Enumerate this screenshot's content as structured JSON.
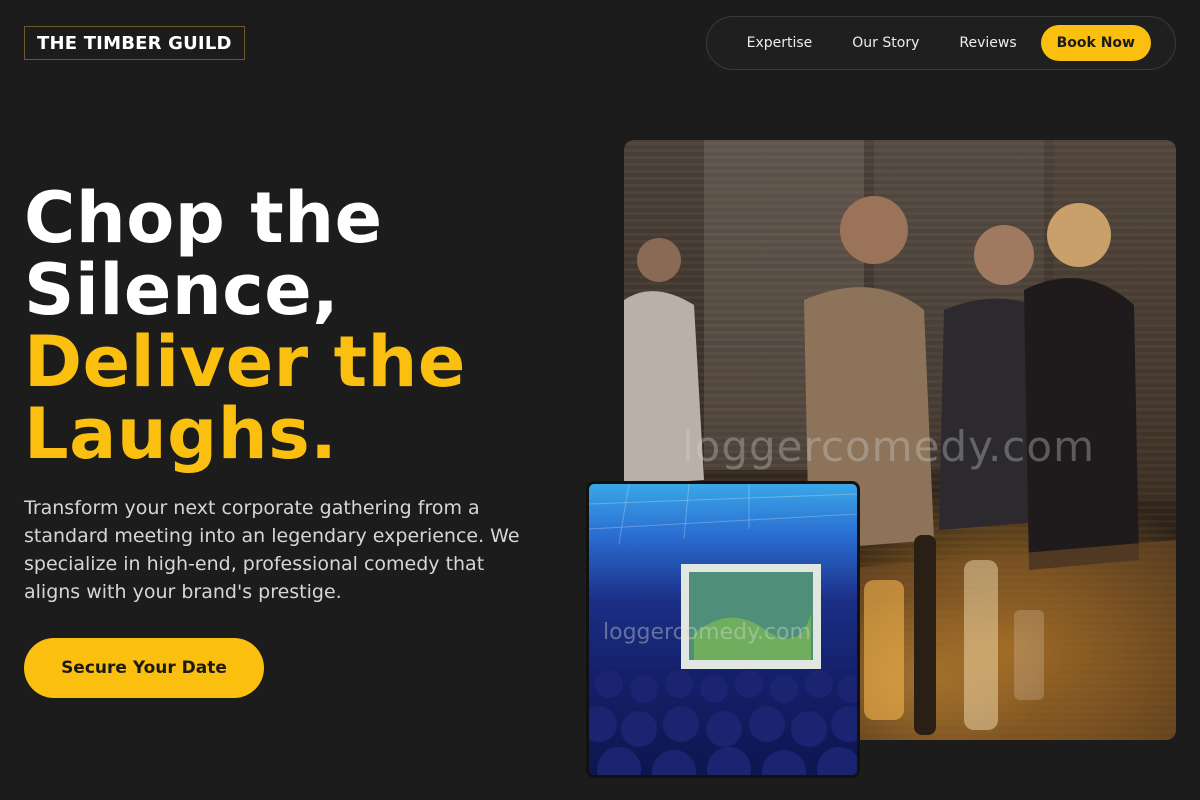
{
  "header": {
    "logo": "THE TIMBER GUILD",
    "nav": [
      {
        "label": "Expertise"
      },
      {
        "label": "Our Story"
      },
      {
        "label": "Reviews"
      }
    ],
    "cta_label": "Book Now"
  },
  "hero": {
    "headline_white_1": "Chop the",
    "headline_white_2": "Silence,",
    "headline_gold_1": "Deliver the",
    "headline_gold_2": "Laughs.",
    "lead": "Transform your next corporate gathering from a standard meeting into an legendary experience. We specialize in high-end, professional comedy that aligns with your brand's prestige.",
    "cta_label": "Secure Your Date"
  },
  "images": {
    "main_watermark": "loggercomedy.com",
    "small_watermark": "loggercomedy.com"
  },
  "colors": {
    "background": "#1c1c1c",
    "accent": "#fbbf10",
    "text": "#ffffff",
    "muted_text": "#d6d6d6"
  }
}
